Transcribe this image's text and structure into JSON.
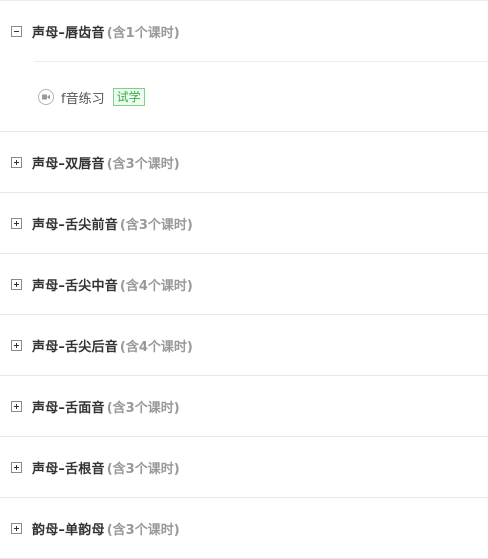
{
  "sections": [
    {
      "title": "声母–唇齿音",
      "count": "(含1个课时)",
      "expanded": true,
      "lessons": [
        {
          "title": "f音练习",
          "badge": "试学",
          "icon": "video-icon"
        }
      ]
    },
    {
      "title": "声母–双唇音",
      "count": "(含3个课时)",
      "expanded": false
    },
    {
      "title": "声母–舌尖前音",
      "count": "(含3个课时)",
      "expanded": false
    },
    {
      "title": "声母–舌尖中音",
      "count": "(含4个课时)",
      "expanded": false
    },
    {
      "title": "声母–舌尖后音",
      "count": "(含4个课时)",
      "expanded": false
    },
    {
      "title": "声母–舌面音",
      "count": "(含3个课时)",
      "expanded": false
    },
    {
      "title": "声母–舌根音",
      "count": "(含3个课时)",
      "expanded": false
    },
    {
      "title": "韵母–单韵母",
      "count": "(含3个课时)",
      "expanded": false
    }
  ],
  "colors": {
    "badge_green": "#38b048",
    "muted": "#999999"
  }
}
